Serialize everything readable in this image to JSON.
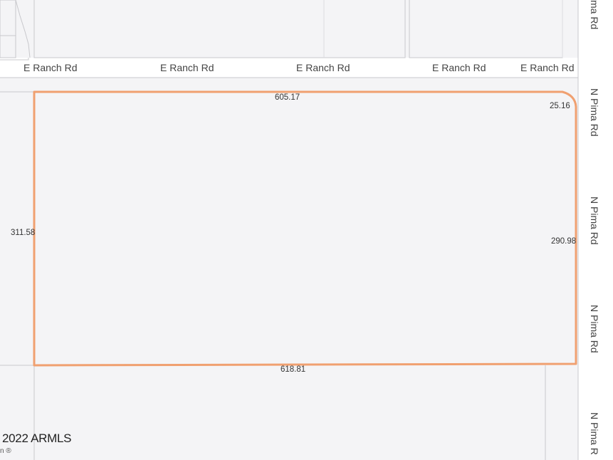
{
  "map": {
    "roads": {
      "ranch": [
        "E Ranch Rd",
        "E Ranch Rd",
        "E Ranch Rd",
        "E Ranch Rd",
        "E Ranch Rd"
      ],
      "pima_top": "ma Rd",
      "pima": [
        "N Pima Rd",
        "N Pima Rd",
        "N Pima Rd",
        "N Pima R"
      ]
    },
    "parcel": {
      "outline_color": "#f0a070",
      "dimensions": {
        "north": "605.17",
        "corner": "25.16",
        "west": "311.58",
        "east": "290.98",
        "south": "618.81"
      }
    },
    "attribution": {
      "copyright": "2022 ARMLS",
      "partial": "n ®"
    }
  }
}
